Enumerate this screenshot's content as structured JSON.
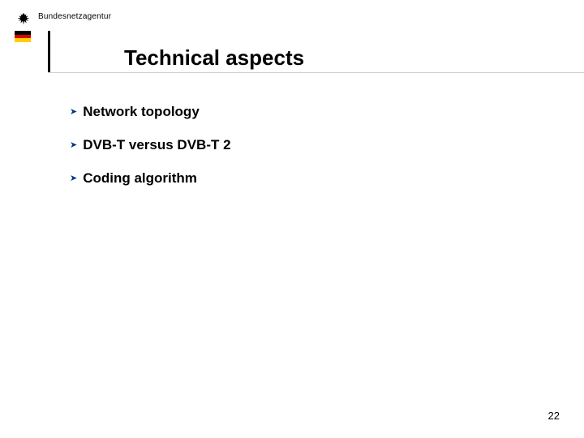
{
  "header": {
    "org_name": "Bundesnetzagentur",
    "flag_colors": {
      "top": "#000000",
      "middle": "#d00000",
      "bottom": "#ffce00"
    },
    "accent_color": "#003a80"
  },
  "title": "Technical aspects",
  "bullets": [
    "Network topology",
    "DVB-T versus DVB-T 2",
    "Coding algorithm"
  ],
  "page_number": "22"
}
